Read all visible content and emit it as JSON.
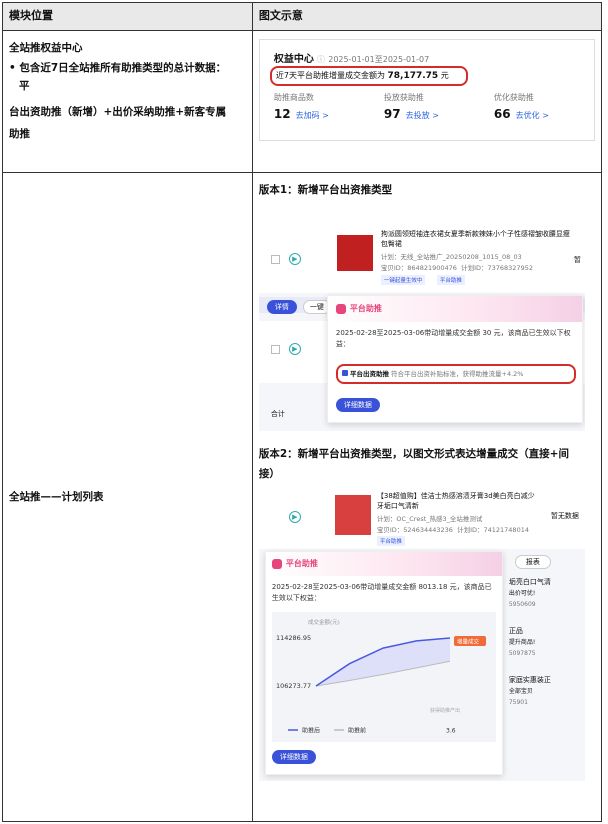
{
  "header": {
    "col1": "模块位置",
    "col2": "图文示意"
  },
  "row1": {
    "title": "全站推权益中心",
    "bullet": "包含近7日全站推所有助推类型的总计数据：平台出资助推（新增）+出价采纳助推+新客专属助推",
    "bullet_line1": "包含近7日全站推所有助推类型的总计数据：",
    "bullet_line2": "平",
    "bullet_line3": "台出资助推（新增）+出价采纳助推+新客专属",
    "bullet_line4": "助推",
    "panel": {
      "title": "权益中心",
      "date": "2025-01-01至2025-01-07",
      "summary_label": "近7天平台助推增量成交金额为",
      "summary_value": "78,177.75",
      "summary_unit": "元",
      "stats": [
        {
          "label": "助推商品数",
          "value": "12",
          "link": "去加码 >"
        },
        {
          "label": "投放获助推",
          "value": "97",
          "link": "去投放 >"
        },
        {
          "label": "优化获助推",
          "value": "66",
          "link": "去优化 >"
        }
      ]
    }
  },
  "row2": {
    "label": "全站推——计划列表",
    "v1": {
      "title": "版本1：新增平台出资推类型",
      "product_title": "拘派圆领短袖连衣裙女夏季新款辣妹小个子性感褶皱收腰显瘦包臀裙",
      "plan_name": "计划：无线_全站推广_20250208_1015_08_03",
      "item_id": "宝贝ID：864821900476",
      "plan_id": "计划ID：73768327952",
      "tag1": "一键起量生效中",
      "tag2": "平台助推",
      "right_text": "暂",
      "detail_btn": "详情",
      "onekey_btn": "一键",
      "popup_title": "平台助推",
      "popup_desc": "2025-02-28至2025-03-06带动增量成交金额 30 元，该商品已生效以下权益：",
      "popup_item": "平台出资助推",
      "popup_item_desc": "符合平台出资补贴标准，获得助推流量+4.2%",
      "popup_btn": "详细数据",
      "total": "合计"
    },
    "v2": {
      "title": "版本2：新增平台出资推类型，以图文形式表达增量成交（直接+间接）",
      "title_line1": "版本2：新增平台出资推类型，以图文形式表达增量成交（直接+间",
      "title_line2": "接）",
      "product_title": "【38超值购】佳洁士热感溶渍牙膏3d美白亮白减少牙垢口气清新",
      "plan_name": "计划：OC_Crest_热感3_全站推测试",
      "item_id": "宝贝ID：524634443236",
      "plan_id": "计划ID：74121748014",
      "tag": "平台助推",
      "right_text": "暂无数据",
      "report_btn": "报表",
      "popup_title": "平台助推",
      "popup_desc": "2025-02-28至2025-03-06带动增量成交金额 8013.18 元，该商品已生效以下权益：",
      "chart_caption": "成交金额(元)",
      "chart_badge": "增量成交",
      "chart_bottom_right": "获得助推产出",
      "legend_after": "助推后",
      "legend_before": "助推前",
      "popup_btn": "详细数据",
      "side_items": [
        {
          "text": "垢亮白口气清",
          "sub": "出价可优!"
        },
        {
          "text": "5950609",
          "sub": ""
        },
        {
          "text": "正品",
          "sub": "提升商品!"
        },
        {
          "text": "5097875",
          "sub": ""
        },
        {
          "text": "家庭实惠装正",
          "sub": "全部宝贝"
        },
        {
          "text": "75901",
          "sub": ""
        }
      ]
    }
  },
  "chart_data": {
    "type": "area",
    "title": "",
    "ylabel": "成交金额(元)",
    "xlabel": "",
    "y_ticks": [
      "114286.95",
      "106273.77"
    ],
    "x_ticks": [
      "3.6"
    ],
    "series": [
      {
        "name": "助推后",
        "values": [
          106273.77,
          110000,
          112600,
          113800,
          114286.95
        ]
      },
      {
        "name": "助推前",
        "values": [
          106273.77,
          107200,
          108200,
          109300,
          110400
        ]
      }
    ],
    "colors": {
      "after": "#4a5ae0",
      "before": "#c8c8d2"
    }
  },
  "colors": {
    "accent": "#3a52d9",
    "alert": "#d42c2c",
    "pink": "#e6467a"
  }
}
